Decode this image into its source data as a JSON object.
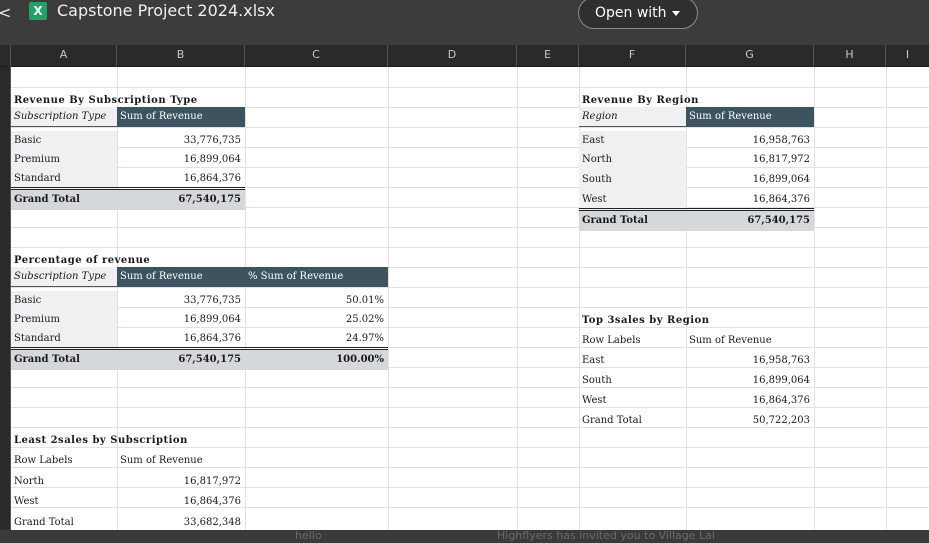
{
  "app": {
    "file_icon_glyph": "X",
    "file_title": "Capstone Project 2024.xlsx",
    "open_with_label": "Open with",
    "back_glyph": "<"
  },
  "columns": [
    "A",
    "B",
    "C",
    "D",
    "E",
    "F",
    "G",
    "H",
    "I"
  ],
  "bottom_ghost": {
    "left_text": "hello",
    "right_text": "Highflyers has invited you to Village Lal"
  },
  "revenue_by_subscription": {
    "title": "Revenue By Subscription Type",
    "col_label": "Subscription Type",
    "col_value": "Sum of Revenue",
    "rows": [
      {
        "label": "Basic",
        "value": "33,776,735"
      },
      {
        "label": "Premium",
        "value": "16,899,064"
      },
      {
        "label": "Standard",
        "value": "16,864,376"
      }
    ],
    "total_label": "Grand Total",
    "total_value": "67,540,175"
  },
  "percentage_of_revenue": {
    "title": "Percentage of revenue",
    "col_label": "Subscription Type",
    "col_value": "Sum of Revenue",
    "col_pct": "% Sum of Revenue",
    "rows": [
      {
        "label": "Basic",
        "value": "33,776,735",
        "pct": "50.01%"
      },
      {
        "label": "Premium",
        "value": "16,899,064",
        "pct": "25.02%"
      },
      {
        "label": "Standard",
        "value": "16,864,376",
        "pct": "24.97%"
      }
    ],
    "total_label": "Grand Total",
    "total_value": "67,540,175",
    "total_pct": "100.00%"
  },
  "least_2_sales": {
    "title": "Least 2sales by Subscription",
    "col_label": "Row Labels",
    "col_value": "Sum of Revenue",
    "rows": [
      {
        "label": "North",
        "value": "16,817,972"
      },
      {
        "label": "West",
        "value": "16,864,376"
      }
    ],
    "total_label": "Grand Total",
    "total_value": "33,682,348"
  },
  "revenue_by_region": {
    "title": "Revenue By Region",
    "col_label": "Region",
    "col_value": "Sum of Revenue",
    "rows": [
      {
        "label": "East",
        "value": "16,958,763"
      },
      {
        "label": "North",
        "value": "16,817,972"
      },
      {
        "label": "South",
        "value": "16,899,064"
      },
      {
        "label": "West",
        "value": "16,864,376"
      }
    ],
    "total_label": "Grand Total",
    "total_value": "67,540,175"
  },
  "top_3_sales_by_region": {
    "title": "Top 3sales by Region",
    "col_label": "Row Labels",
    "col_value": "Sum of Revenue",
    "rows": [
      {
        "label": "East",
        "value": "16,958,763"
      },
      {
        "label": "South",
        "value": "16,899,064"
      },
      {
        "label": "West",
        "value": "16,864,376"
      }
    ],
    "total_label": "Grand Total",
    "total_value": "50,722,203"
  },
  "colors": {
    "header_fill": "#3d5460",
    "label_fill": "#eef0f2",
    "total_fill": "#d4d8db",
    "excel_green": "#21a366"
  }
}
